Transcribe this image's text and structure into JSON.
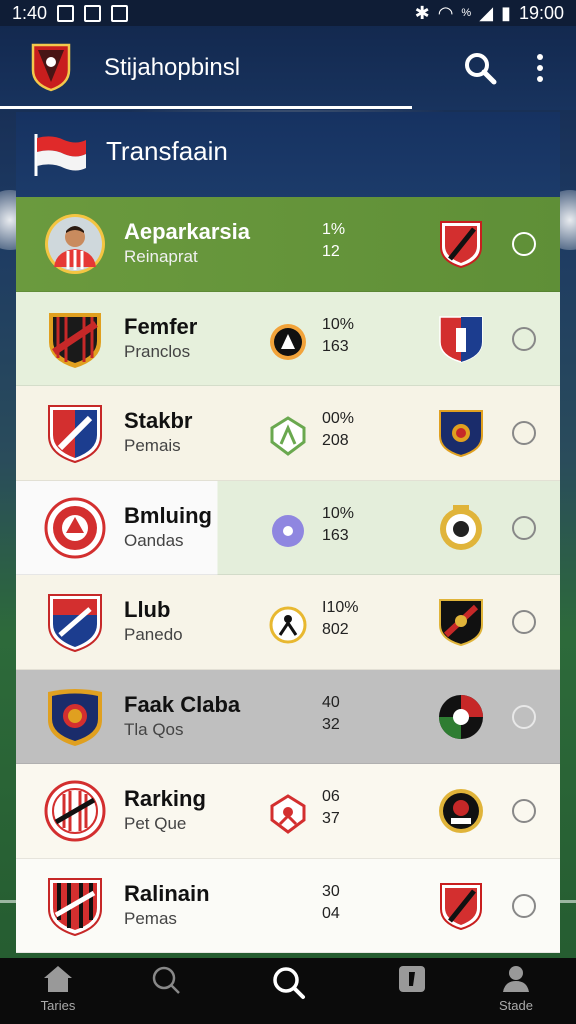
{
  "status_bar": {
    "time_left": "1:40",
    "network": "%",
    "time_right": "19:00"
  },
  "app_bar": {
    "title": "Stijahopbinsl"
  },
  "section": {
    "title": "Transfaain"
  },
  "rows": [
    {
      "name": "Aeparkarsia",
      "sub": "Reinaprat",
      "stat1": "1%",
      "stat2": "12",
      "crest": "player-avatar",
      "mid_icon": "",
      "opponent_crest": "red-shield-crest"
    },
    {
      "name": "Femfer",
      "sub": "Pranclos",
      "stat1": "10%",
      "stat2": "163",
      "crest": "black-red-striped-crest",
      "mid_icon": "orange-circle-icon",
      "opponent_crest": "red-blue-shield-crest"
    },
    {
      "name": "Stakbr",
      "sub": "Pemais",
      "stat1": "00%",
      "stat2": "208",
      "crest": "red-blue-shield-crest",
      "mid_icon": "green-shield-icon",
      "opponent_crest": "navy-shield-crest"
    },
    {
      "name": "Bmluing",
      "sub": "Oandas",
      "stat1": "10%",
      "stat2": "163",
      "crest": "red-round-crest",
      "mid_icon": "purple-circle-icon",
      "opponent_crest": "gold-round-crest"
    },
    {
      "name": "Llub",
      "sub": "Panedo",
      "stat1": "I10%",
      "stat2": "802",
      "crest": "red-blue-shield-crest",
      "mid_icon": "yellow-circle-icon",
      "opponent_crest": "black-yellow-shield-crest"
    },
    {
      "name": "Faak Claba",
      "sub": "Tla Qos",
      "stat1": "40",
      "stat2": "32",
      "crest": "navy-gold-crest",
      "mid_icon": "",
      "opponent_crest": "red-green-round-crest"
    },
    {
      "name": "Rarking",
      "sub": "Pet Que",
      "stat1": "06",
      "stat2": "37",
      "crest": "red-striped-round-crest",
      "mid_icon": "red-shield-icon",
      "opponent_crest": "black-red-round-crest"
    },
    {
      "name": "Ralinain",
      "sub": "Pemas",
      "stat1": "30",
      "stat2": "04",
      "crest": "red-black-shield-crest",
      "mid_icon": "",
      "opponent_crest": "red-shield-crest"
    }
  ],
  "bottom_nav": [
    {
      "label": "Taries",
      "icon": "home-icon"
    },
    {
      "label": "",
      "icon": "search-outline-icon"
    },
    {
      "label": "",
      "icon": "search-icon"
    },
    {
      "label": "",
      "icon": "card-icon"
    },
    {
      "label": "Stade",
      "icon": "profile-icon"
    }
  ],
  "colors": {
    "header": "#13294f",
    "active_row": "#6b9a3e",
    "highlight_row": "#bfbfbf",
    "crest_red": "#d42a2a",
    "crest_blue": "#1c3d8f"
  }
}
